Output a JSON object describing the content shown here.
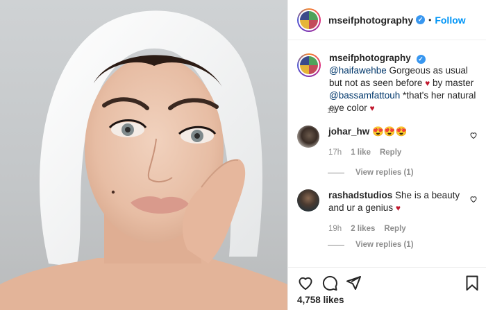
{
  "header": {
    "username": "mseifphotography",
    "separator": "•",
    "follow_label": "Follow"
  },
  "caption": {
    "username": "mseifphotography",
    "mention1": "@haifawehbe",
    "text1": "Gorgeous as usual but not as seen before",
    "heart": "♥",
    "text2": "by master",
    "mention2": "@bassamfattouh",
    "text3": "*that's her natural eye color",
    "time": "1d"
  },
  "comments": [
    {
      "username": "johar_hw",
      "text": "😍😍😍",
      "time": "17h",
      "likes": "1 like",
      "reply_label": "Reply",
      "view_replies": "View replies (1)"
    },
    {
      "username": "rashadstudios",
      "text": "She is a beauty and ur a genius",
      "heart": "♥",
      "time": "19h",
      "likes": "2 likes",
      "reply_label": "Reply",
      "view_replies": "View replies (1)"
    }
  ],
  "footer": {
    "likes_count": "4,758 likes"
  },
  "icons": {
    "like": "heart-outline-icon",
    "comment": "comment-bubble-icon",
    "share": "paper-plane-icon",
    "save": "bookmark-icon",
    "verified": "verified-badge-icon"
  },
  "colors": {
    "accent": "#0095f6",
    "verified": "#3897f0",
    "heart": "#c0172d",
    "muted": "#8e8e8e"
  }
}
